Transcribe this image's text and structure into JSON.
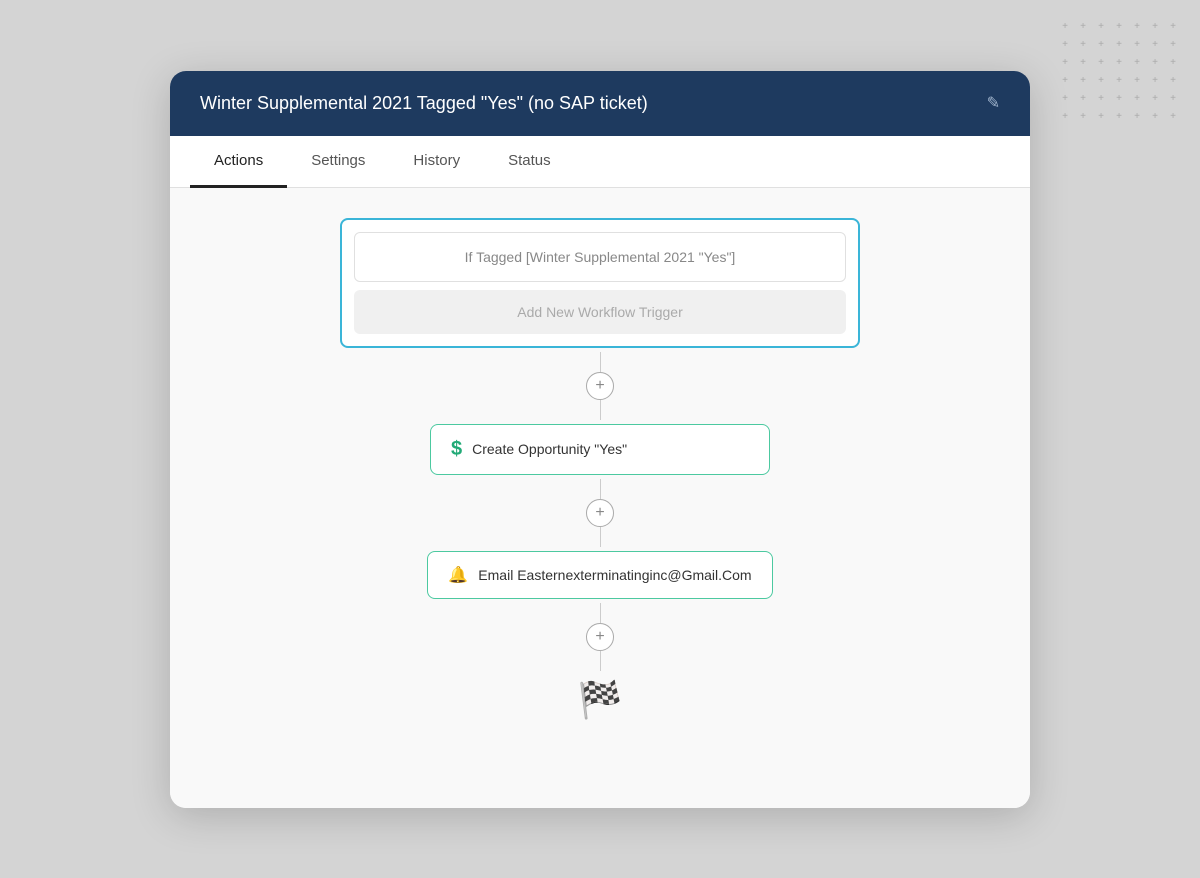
{
  "header": {
    "title": "Winter Supplemental 2021 Tagged \"Yes\" (no SAP ticket)",
    "edit_icon": "✎"
  },
  "tabs": [
    {
      "id": "actions",
      "label": "Actions",
      "active": true
    },
    {
      "id": "settings",
      "label": "Settings",
      "active": false
    },
    {
      "id": "history",
      "label": "History",
      "active": false
    },
    {
      "id": "status",
      "label": "Status",
      "active": false
    }
  ],
  "workflow": {
    "trigger": {
      "condition_text": "If Tagged [Winter Supplemental 2021 \"Yes\"]",
      "add_trigger_text": "Add New Workflow Trigger"
    },
    "actions": [
      {
        "id": "create-opportunity",
        "icon": "$",
        "icon_type": "dollar",
        "label": "Create Opportunity \"Yes\""
      },
      {
        "id": "email-action",
        "icon": "🔔",
        "icon_type": "bell",
        "label": "Email Easternexterminatinginc@Gmail.Com"
      }
    ],
    "finish_icon": "🏁"
  },
  "plus_pattern": [
    "+",
    "+",
    "+",
    "+",
    "+",
    "+",
    "+",
    "+",
    "+",
    "+",
    "+",
    "+",
    "+",
    "+",
    "+",
    "+",
    "+",
    "+",
    "+",
    "+",
    "+",
    "+",
    "+",
    "+",
    "+",
    "+",
    "+",
    "+",
    "+",
    "+",
    "+",
    "+",
    "+",
    "+",
    "+",
    "+",
    "+",
    "+",
    "+",
    "+",
    "+",
    "+"
  ]
}
